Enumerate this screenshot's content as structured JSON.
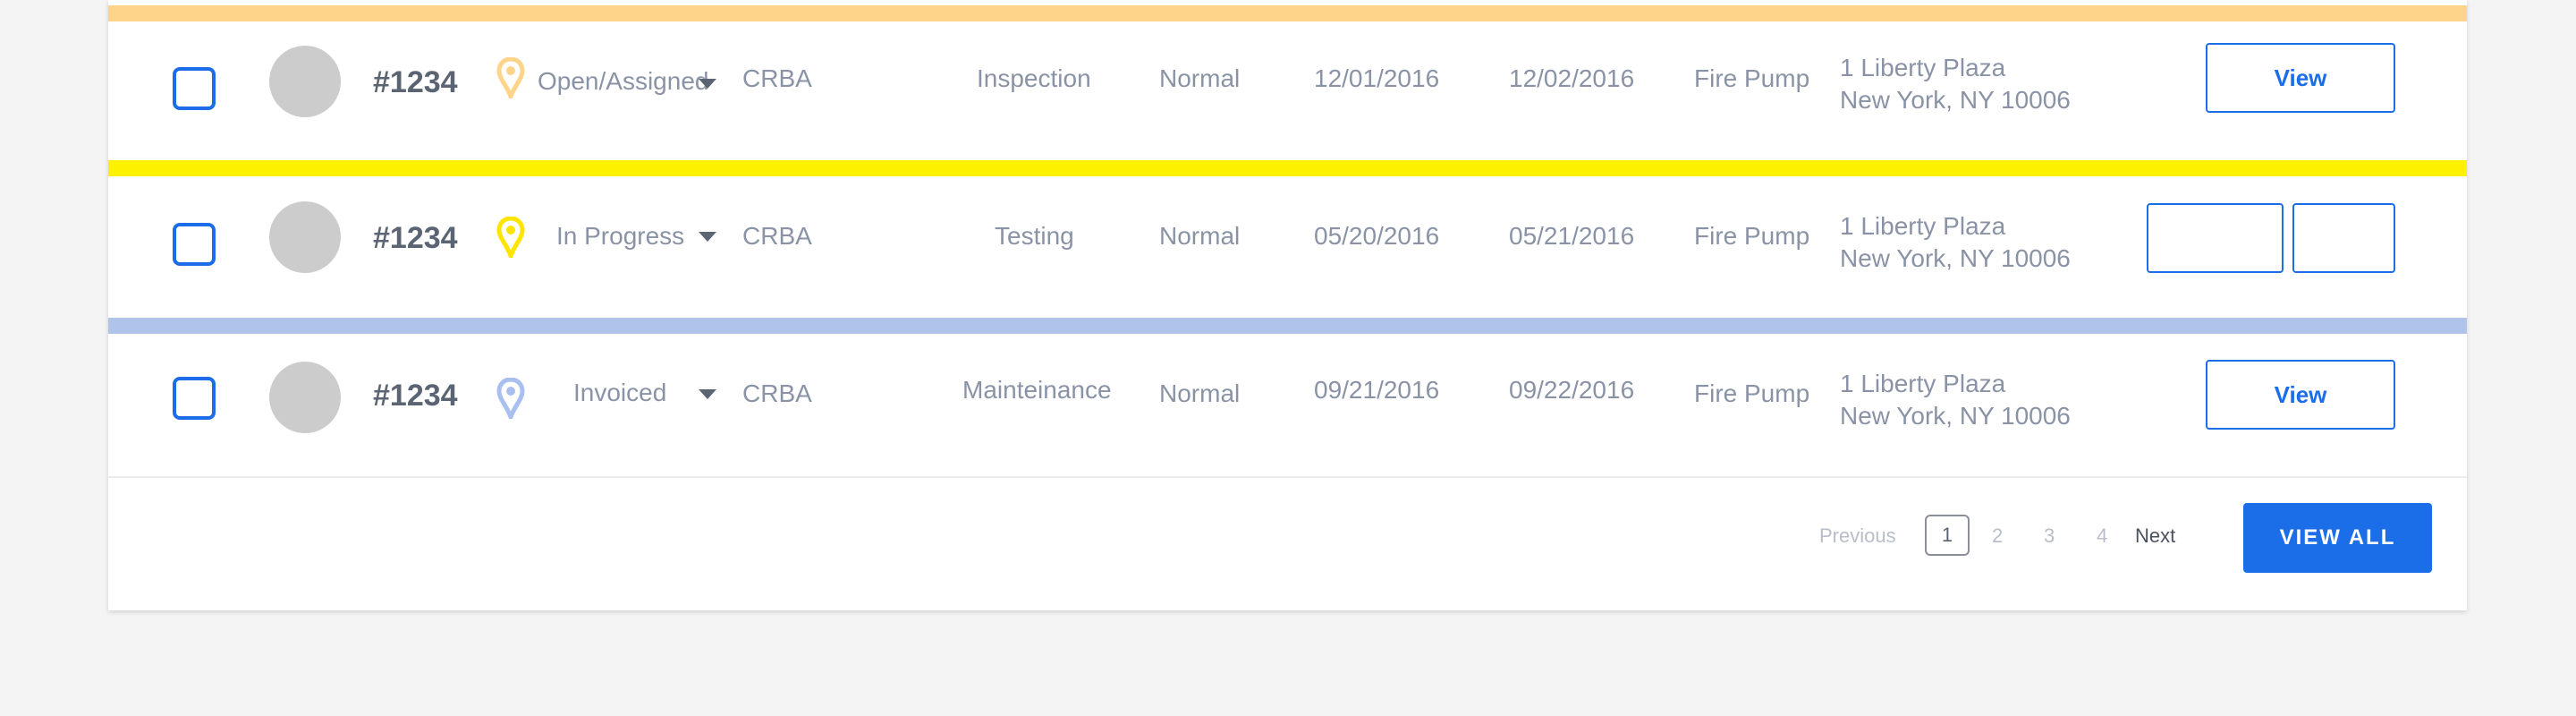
{
  "colors": {
    "accent": "#1c6de8",
    "stripe_open_assigned": "#fdd48a",
    "stripe_in_progress": "#fdf100",
    "stripe_invoiced": "#b0c4ea"
  },
  "rows": [
    {
      "ticket": "#1234",
      "status": "Open/Assigned",
      "pin_icon": "map-pin-icon",
      "pin_color": "#fdd48a",
      "company": "CRBA",
      "type": "Inspection",
      "priority": "Normal",
      "start_date": "12/01/2016",
      "end_date": "12/02/2016",
      "equipment": "Fire Pump",
      "address_line1": "1 Liberty Plaza",
      "address_line2": "New York, NY 10006",
      "action_label": "View"
    },
    {
      "ticket": "#1234",
      "status": "In Progress",
      "pin_icon": "map-pin-icon",
      "pin_color": "#fde500",
      "company": "CRBA",
      "type": "Testing",
      "priority": "Normal",
      "start_date": "05/20/2016",
      "end_date": "05/21/2016",
      "equipment": "Fire Pump",
      "address_line1": "1 Liberty Plaza",
      "address_line2": "New York, NY 10006",
      "action_label": ""
    },
    {
      "ticket": "#1234",
      "status": "Invoiced",
      "pin_icon": "map-pin-icon",
      "pin_color": "#a9bff0",
      "company": "CRBA",
      "type": "Mainteinance",
      "priority": "Normal",
      "start_date": "09/21/2016",
      "end_date": "09/22/2016",
      "equipment": "Fire Pump",
      "address_line1": "1 Liberty Plaza",
      "address_line2": "New York, NY 10006",
      "action_label": "View"
    }
  ],
  "pagination": {
    "previous_label": "Previous",
    "pages": [
      "1",
      "2",
      "3",
      "4"
    ],
    "current_page": "1",
    "next_label": "Next"
  },
  "view_all_label": "VIEW ALL"
}
